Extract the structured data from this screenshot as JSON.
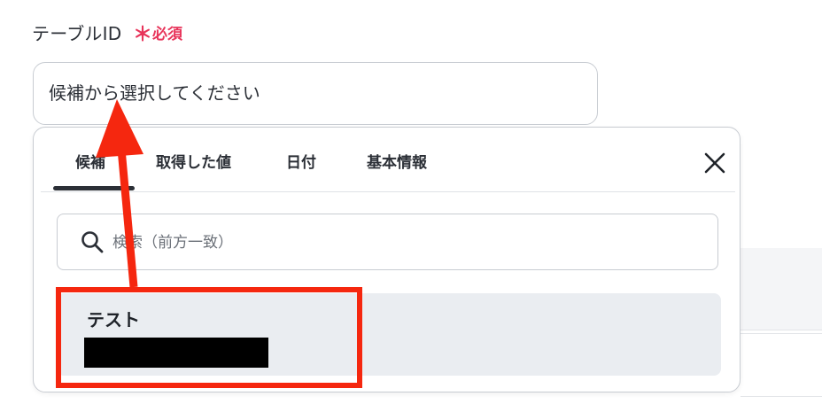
{
  "form": {
    "field_label": "テーブルID",
    "required_mark": "＊",
    "required_text": "必須",
    "select_placeholder": "候補から選択してください"
  },
  "dropdown": {
    "tabs": [
      {
        "label": "候補",
        "active": true
      },
      {
        "label": "取得した値",
        "active": false
      },
      {
        "label": "日付",
        "active": false
      },
      {
        "label": "基本情報",
        "active": false
      }
    ],
    "close_icon": "close-icon",
    "search": {
      "placeholder": "検索（前方一致）",
      "icon": "search-icon"
    },
    "options": [
      {
        "title": "テスト",
        "subtitle_redacted": true
      }
    ]
  },
  "annotation": {
    "highlight_color": "#f5270f",
    "arrow_color": "#f5270f"
  },
  "colors": {
    "required": "#e8345a",
    "option_bg": "#eaedf1",
    "border": "#c8ccd2"
  }
}
